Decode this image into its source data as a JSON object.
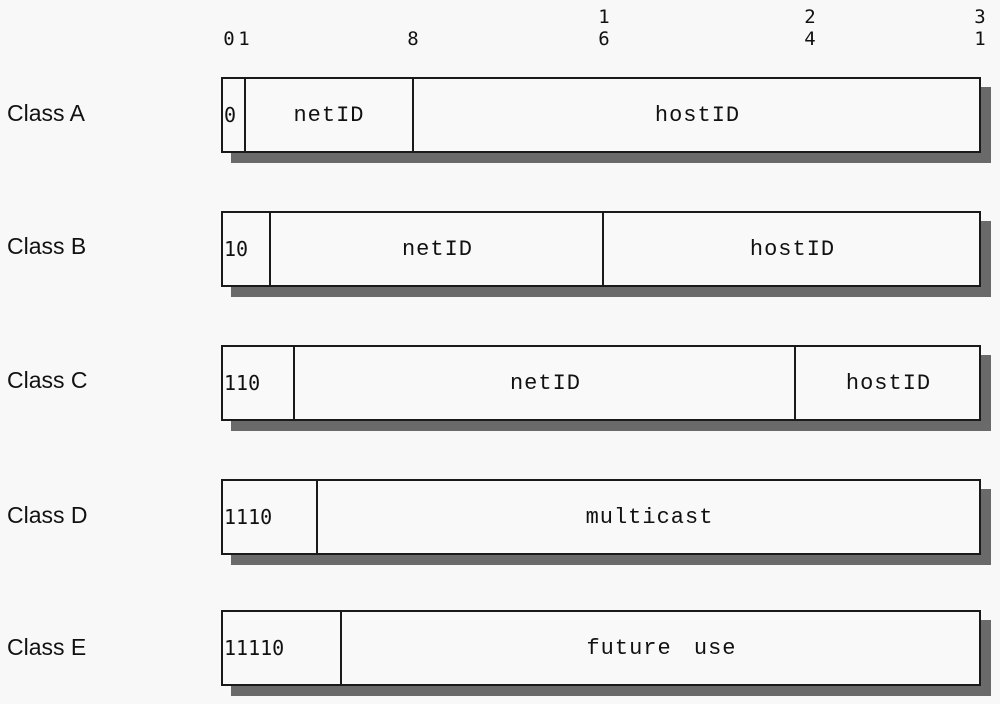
{
  "bit_ruler": {
    "ticks": [
      {
        "line1": "",
        "line2": "0"
      },
      {
        "line1": "",
        "line2": "1"
      },
      {
        "line1": "",
        "line2": "8"
      },
      {
        "line1": "1",
        "line2": "6"
      },
      {
        "line1": "2",
        "line2": "4"
      },
      {
        "line1": "3",
        "line2": "1"
      }
    ]
  },
  "classes": [
    {
      "name": "Class A",
      "prefix": "0",
      "fields": [
        "netID",
        "hostID"
      ]
    },
    {
      "name": "Class B",
      "prefix": "10",
      "fields": [
        "netID",
        "hostID"
      ]
    },
    {
      "name": "Class C",
      "prefix": "110",
      "fields": [
        "netID",
        "hostID"
      ]
    },
    {
      "name": "Class D",
      "prefix": "1110",
      "fields": [
        "multicast"
      ]
    },
    {
      "name": "Class E",
      "prefix": "11110",
      "fields": [
        "future use"
      ]
    }
  ]
}
